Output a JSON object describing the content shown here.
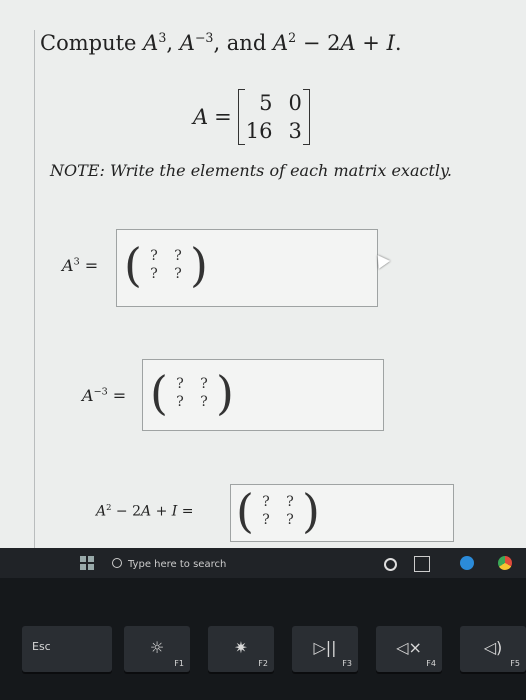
{
  "question": {
    "prefix": "Compute ",
    "term1_base": "A",
    "term1_exp": "3",
    "sep1": ", ",
    "term2_base": "A",
    "term2_exp": "−3",
    "sep2": ", and ",
    "term3_base": "A",
    "term3_exp": "2",
    "term3_rest": " − 2",
    "term3_a": "A",
    "term3_plus": " + ",
    "term3_i": "I",
    "suffix": "."
  },
  "matrix": {
    "name": "A",
    "eq": " =",
    "entries": [
      "5",
      "0",
      "16",
      "3"
    ]
  },
  "note": "NOTE: Write the elements of each matrix exactly.",
  "answers": {
    "a_cubed": {
      "base": "A",
      "exp": "3",
      "eq": " =",
      "cells": [
        "?",
        "?",
        "?",
        "?"
      ]
    },
    "a_inv_cubed": {
      "base": "A",
      "exp": "−3",
      "eq": " =",
      "cells": [
        "?",
        "?",
        "?",
        "?"
      ]
    },
    "poly": {
      "base": "A",
      "exp": "2",
      "rest": " − 2",
      "a": "A",
      "plus": " + ",
      "i": "I",
      "eq": " =",
      "cells": [
        "?",
        "?",
        "?",
        "?"
      ]
    }
  },
  "taskbar": {
    "search_placeholder": "Type here to search"
  },
  "keys": [
    {
      "label": "Esc",
      "fn": ""
    },
    {
      "label": "☼",
      "fn": "F1"
    },
    {
      "label": "✷",
      "fn": "F2"
    },
    {
      "label": "▷||",
      "fn": "F3"
    },
    {
      "label": "◁×",
      "fn": "F4"
    },
    {
      "label": "◁)",
      "fn": "F5"
    }
  ]
}
